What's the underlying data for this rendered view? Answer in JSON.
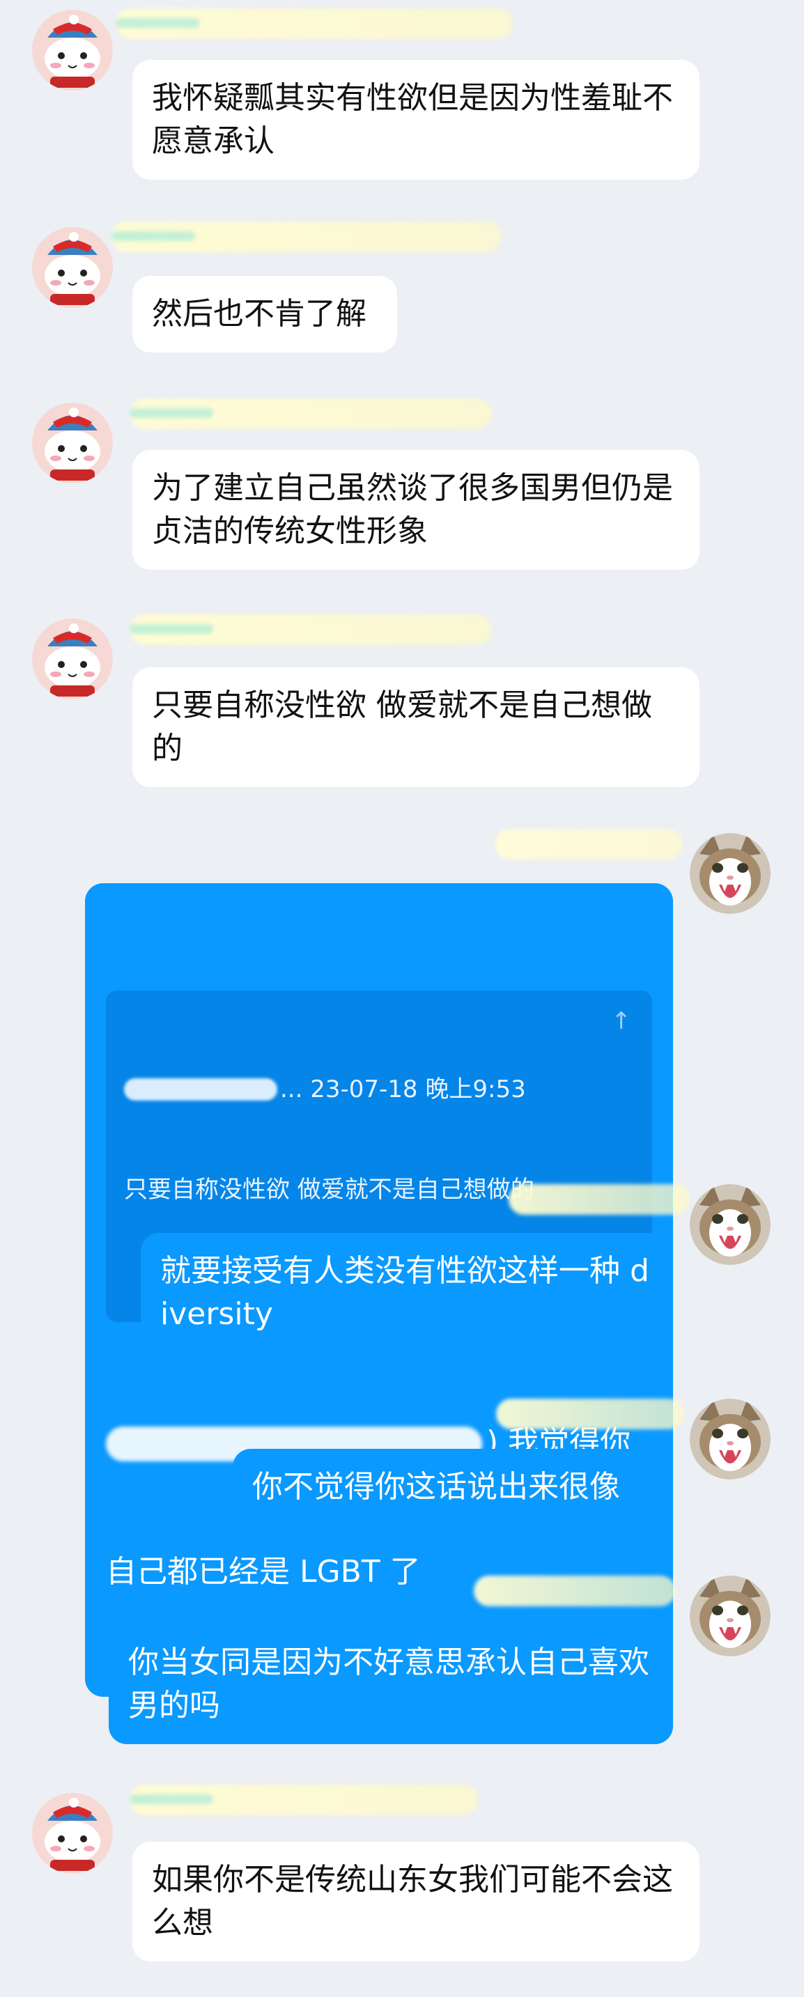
{
  "colors": {
    "background": "#eceff4",
    "incoming_bubble": "#ffffff",
    "outgoing_bubble": "#0a99ff",
    "quote_block": "#0585e8"
  },
  "messages": [
    {
      "side": "in",
      "text": "我怀疑瓢其实有性欲但是因为性羞耻不愿意承认"
    },
    {
      "side": "in",
      "text": "然后也不肯了解"
    },
    {
      "side": "in",
      "text": "为了建立自己虽然谈了很多国男但仍是贞洁的传统女性形象"
    },
    {
      "side": "in",
      "text": "只要自称没性欲 做爱就不是自己想做的"
    },
    {
      "side": "out",
      "quote": {
        "meta_suffix": "... 23-07-18 晚上9:53",
        "text": "只要自称没性欲 做爱就不是自己想做的",
        "pin_icon": "↑"
      },
      "text_after_redact": ") 我觉得你",
      "text_line2": "自己都已经是 LGBT 了"
    },
    {
      "side": "out",
      "text": "就要接受有人类没有性欲这样一种 diversity"
    },
    {
      "side": "out",
      "text": "你不觉得你这话说出来很像"
    },
    {
      "side": "out",
      "text": "你当女同是因为不好意思承认自己喜欢男的吗"
    },
    {
      "side": "in",
      "text": "如果你不是传统山东女我们可能不会这么想"
    }
  ],
  "icons": {
    "incoming_avatar": "cartoon-cat-avatar-icon",
    "outgoing_avatar": "screaming-cat-avatar-icon"
  }
}
